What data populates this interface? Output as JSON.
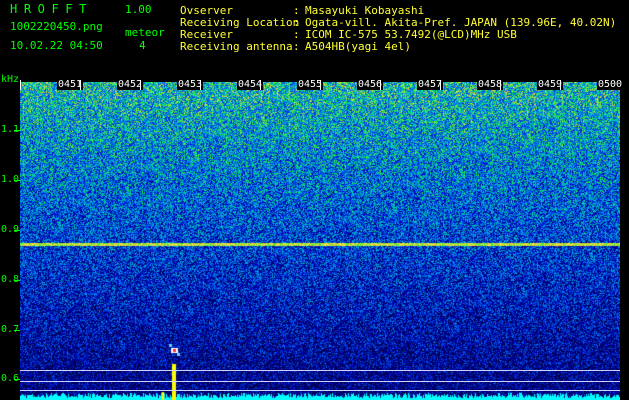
{
  "header": {
    "app_title": "HROFFT",
    "app_version": "1.00",
    "file_name": "1002220450.png",
    "datetime": "10.02.22 04:50",
    "meteor_label": "meteor",
    "meteor_count": "4"
  },
  "info": [
    {
      "label": "Ovserver",
      "value": "Masayuki Kobayashi"
    },
    {
      "label": "Receiving Location",
      "value": "Ogata-vill. Akita-Pref. JAPAN (139.96E, 40.02N)"
    },
    {
      "label": "Receiver",
      "value": "ICOM IC-575 53.7492(@LCD)MHz USB"
    },
    {
      "label": "Receiving antenna",
      "value": "A504HB(yagi 4el)"
    }
  ],
  "info_separator": ":",
  "axis": {
    "unit_label": "kHz",
    "freq_ticks": [
      "1.1",
      "1.0",
      "0.9",
      "0.8",
      "0.7",
      "0.6"
    ],
    "time_ticks": [
      "0451",
      "0452",
      "0453",
      "0454",
      "0455",
      "0456",
      "0457",
      "0458",
      "0459",
      "0500"
    ]
  },
  "colors": {
    "text_green": "#00ff00",
    "text_yellow": "#ffff33",
    "time_text": "#ffffff",
    "background": "#000000",
    "carrier_line": "#ffcc44",
    "signal_trace": "#00ffff",
    "meteor_echo": "#ffff00"
  },
  "spectrogram": {
    "freq_range_khz": [
      0.58,
      1.19
    ],
    "time_range": [
      "0450",
      "0500"
    ],
    "carrier_freq_khz": 0.88,
    "reference_lines_khz": [
      0.62,
      0.608,
      0.598
    ],
    "meteor_time_fraction": 0.26,
    "meteor_freq_khz": 0.675
  }
}
